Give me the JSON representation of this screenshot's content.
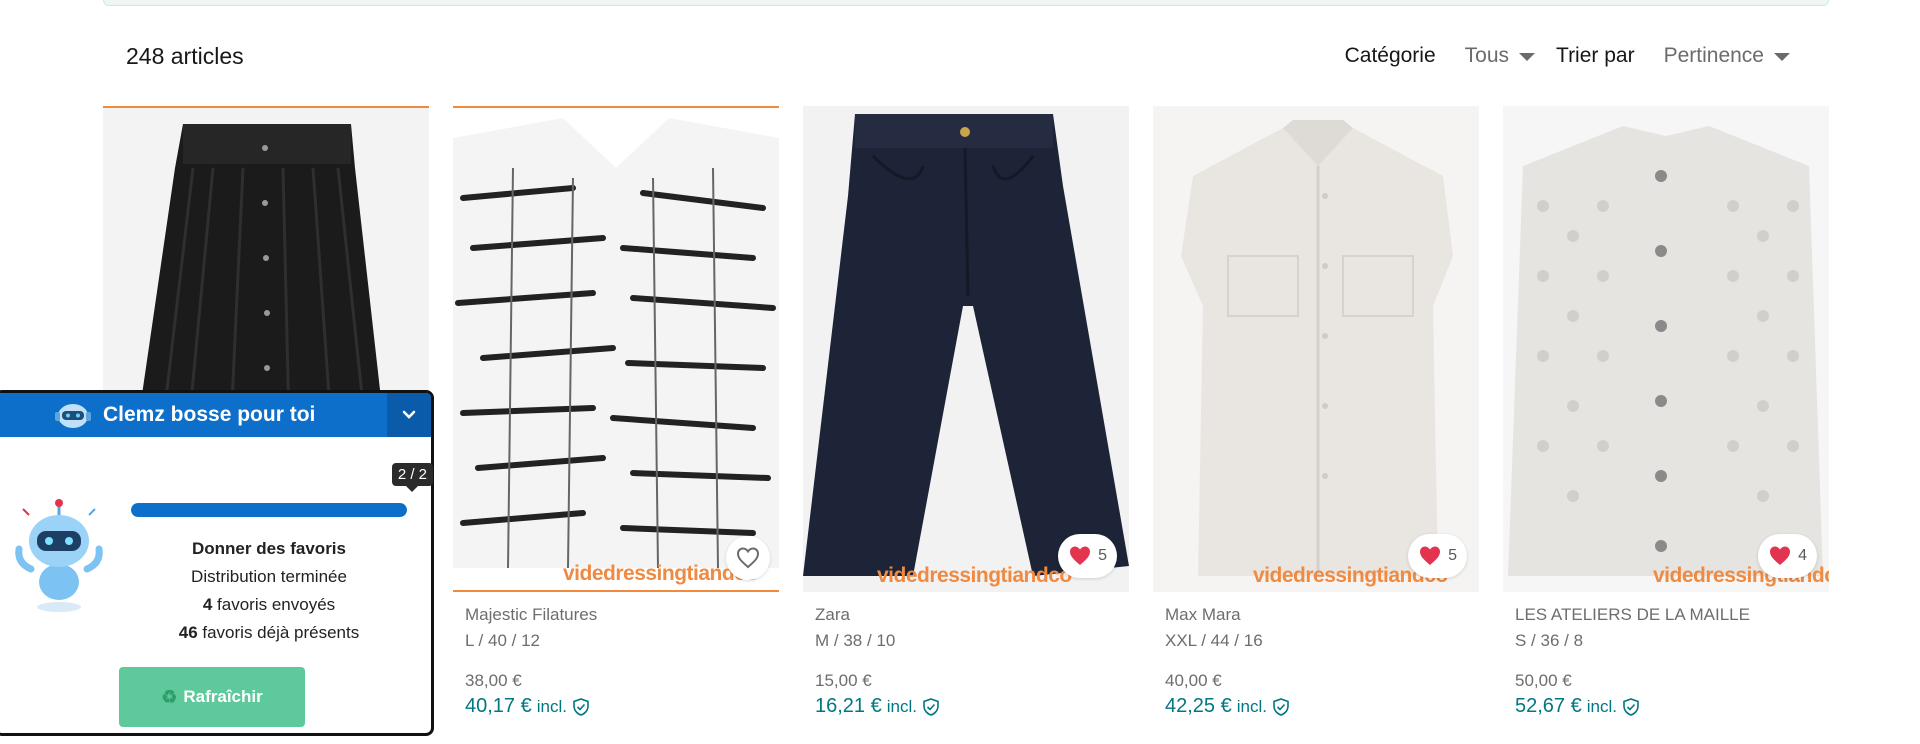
{
  "results": {
    "count_label": "248 articles"
  },
  "filters": {
    "category_label": "Catégorie",
    "category_value": "Tous",
    "sort_label": "Trier par",
    "sort_value": "Pertinence"
  },
  "items": [
    {
      "brand": "",
      "size": "",
      "price": "",
      "price_incl": "",
      "favorites": "",
      "watermark": ""
    },
    {
      "brand": "Majestic Filatures",
      "size": "L / 40 / 12",
      "price": "38,00 €",
      "price_incl": "40,17 €",
      "incl_label": "incl.",
      "favorites": "",
      "watermark": "videdressingtiandco"
    },
    {
      "brand": "Zara",
      "size": "M / 38 / 10",
      "price": "15,00 €",
      "price_incl": "16,21 €",
      "incl_label": "incl.",
      "favorites": "5",
      "watermark": "videdressingtiandco"
    },
    {
      "brand": "Max Mara",
      "size": "XXL / 44 / 16",
      "price": "40,00 €",
      "price_incl": "42,25 €",
      "incl_label": "incl.",
      "favorites": "5",
      "watermark": "videdressingtiandco"
    },
    {
      "brand": "LES ATELIERS DE LA MAILLE",
      "size": "S / 36 / 8",
      "price": "50,00 €",
      "price_incl": "52,67 €",
      "incl_label": "incl.",
      "favorites": "4",
      "watermark": "videdressingtiandco"
    }
  ],
  "widget": {
    "title": "Clemz bosse pour toi",
    "step": "2 / 2",
    "progress": 1.0,
    "task_title": "Donner des favoris",
    "status": "Distribution terminée",
    "sent_count": "4",
    "sent_label": " favoris envoyés",
    "existing_count": "46",
    "existing_label": " favoris déjà présents",
    "refresh_label": "Rafraîchir"
  },
  "colors": {
    "accent": "#007782",
    "widget_blue": "#0d6fc9",
    "refresh_green": "#5ec99a",
    "heart_red": "#e2344f",
    "boost_orange": "#f08a3c"
  },
  "icons": [
    "heart-outline-icon",
    "heart-filled-icon",
    "shield-check-icon",
    "chevron-down-icon",
    "robot-icon",
    "recycle-icon",
    "caret-down-icon"
  ]
}
